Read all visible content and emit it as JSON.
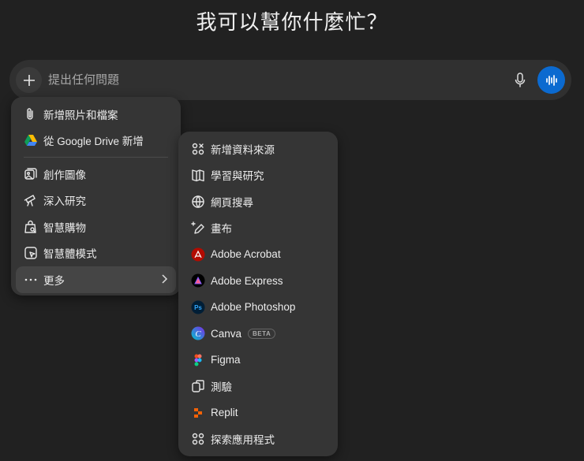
{
  "title": "我可以幫你什麼忙？",
  "composer": {
    "placeholder": "提出任何問題",
    "colors": {
      "voice_button": "#0b6ad0"
    }
  },
  "left_menu": {
    "items": [
      {
        "label": "新增照片和檔案",
        "icon": "paperclip-icon"
      },
      {
        "label": "從 Google Drive 新增",
        "icon": "google-drive-icon"
      },
      {
        "divider": true
      },
      {
        "label": "創作圖像",
        "icon": "image-create-icon"
      },
      {
        "label": "深入研究",
        "icon": "telescope-icon"
      },
      {
        "label": "智慧購物",
        "icon": "shopping-bag-icon"
      },
      {
        "label": "智慧體模式",
        "icon": "agent-cursor-icon"
      },
      {
        "label": "更多",
        "icon": "more-dots-icon",
        "highlighted": true,
        "submenu": true
      }
    ]
  },
  "right_menu": {
    "items": [
      {
        "label": "新增資料來源",
        "icon": "connectors-icon"
      },
      {
        "label": "學習與研究",
        "icon": "book-icon"
      },
      {
        "label": "網頁搜尋",
        "icon": "globe-icon"
      },
      {
        "label": "畫布",
        "icon": "canvas-pen-icon"
      },
      {
        "label": "Adobe Acrobat",
        "icon": "adobe-acrobat-icon"
      },
      {
        "label": "Adobe Express",
        "icon": "adobe-express-icon"
      },
      {
        "label": "Adobe Photoshop",
        "icon": "adobe-photoshop-icon"
      },
      {
        "label": "Canva",
        "icon": "canva-icon",
        "badge": "BETA"
      },
      {
        "label": "Figma",
        "icon": "figma-icon"
      },
      {
        "label": "測驗",
        "icon": "quiz-cards-icon"
      },
      {
        "label": "Replit",
        "icon": "replit-icon"
      },
      {
        "label": "探索應用程式",
        "icon": "apps-grid-icon"
      }
    ]
  }
}
